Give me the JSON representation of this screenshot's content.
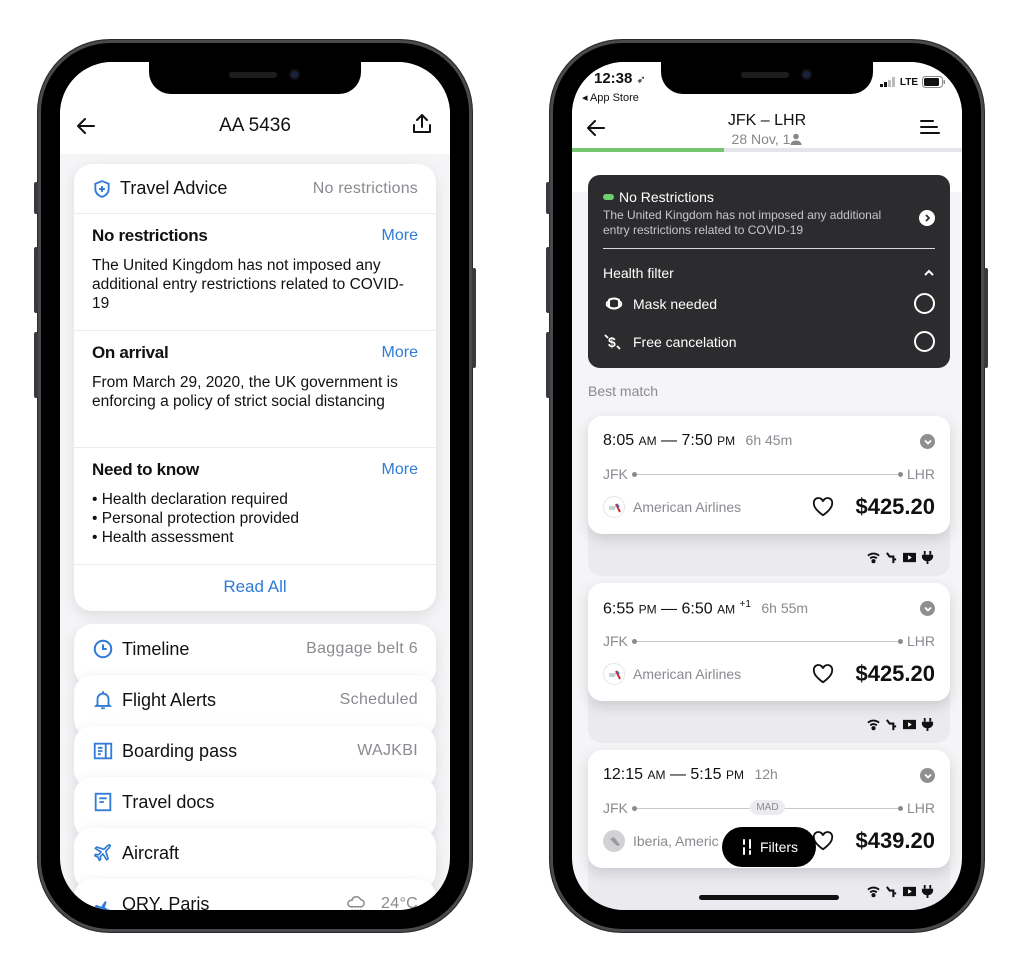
{
  "left_phone": {
    "header": {
      "title": "AA 5436",
      "back_icon": "arrow-left-icon",
      "share_icon": "share-icon"
    },
    "travel_advice": {
      "label": "Travel Advice",
      "value": "No restrictions",
      "icon": "shield-plus-icon",
      "sections": [
        {
          "heading": "No restrictions",
          "more_label": "More",
          "body": "The United Kingdom has not imposed any additional entry restrictions related to COVID-19"
        },
        {
          "heading": "On arrival",
          "more_label": "More",
          "body": "From March 29, 2020, the UK government is enforcing a policy of strict social distancing"
        },
        {
          "heading": "Need to know",
          "more_label": "More",
          "bullets": [
            "Health declaration required",
            "Personal protection provided",
            "Health assessment"
          ]
        }
      ],
      "read_all_label": "Read All"
    },
    "list_items": [
      {
        "label": "Timeline",
        "value": "Baggage belt 6",
        "icon": "clock-icon"
      },
      {
        "label": "Flight Alerts",
        "value": "Scheduled",
        "icon": "bell-icon"
      },
      {
        "label": "Boarding pass",
        "value": "WAJKBI",
        "icon": "boarding-pass-icon"
      },
      {
        "label": "Travel docs",
        "value": "",
        "icon": "document-icon"
      },
      {
        "label": "Aircraft",
        "value": "",
        "icon": "airplane-icon"
      },
      {
        "label": "ORY, Paris",
        "value": "24°C",
        "icon": "plane-landing-icon",
        "weather_icon": "rain-cloud-icon"
      }
    ],
    "accent_color": "#2f7bd6"
  },
  "right_phone": {
    "status_bar": {
      "time": "12:38",
      "back_app": "◂ App Store",
      "network": "LTE"
    },
    "header": {
      "title": "JFK – LHR",
      "subtitle": "28 Nov, 1",
      "progress": 0.39
    },
    "restrictions_card": {
      "title": "No Restrictions",
      "body": "The United Kingdom has not imposed any additional entry restrictions related to COVID-19",
      "health_filter_label": "Health filter",
      "options": [
        {
          "label": "Mask needed",
          "icon": "mask-icon",
          "checked": false
        },
        {
          "label": "Free cancelation",
          "icon": "no-fee-icon",
          "checked": false
        }
      ]
    },
    "section_label": "Best match",
    "flights": [
      {
        "dep_time": "8:05",
        "dep_ampm": "AM",
        "arr_time": "7:50",
        "arr_ampm": "PM",
        "day_offset": "",
        "duration": "6h 45m",
        "from": "JFK",
        "to": "LHR",
        "stop": "",
        "airline": "American Airlines",
        "price": "$425.20"
      },
      {
        "dep_time": "6:55",
        "dep_ampm": "PM",
        "arr_time": "6:50",
        "arr_ampm": "AM",
        "day_offset": "+1",
        "duration": "6h 55m",
        "from": "JFK",
        "to": "LHR",
        "stop": "",
        "airline": "American Airlines",
        "price": "$425.20"
      },
      {
        "dep_time": "12:15",
        "dep_ampm": "AM",
        "arr_time": "5:15",
        "arr_ampm": "PM",
        "day_offset": "",
        "duration": "12h",
        "from": "JFK",
        "to": "LHR",
        "stop": "MAD",
        "airline": "Iberia, Americ",
        "price": "$439.20"
      }
    ],
    "amenities": [
      "wifi-icon",
      "seat-icon",
      "video-icon",
      "power-icon"
    ],
    "filters_label": "Filters",
    "green_color": "#74c66f"
  }
}
